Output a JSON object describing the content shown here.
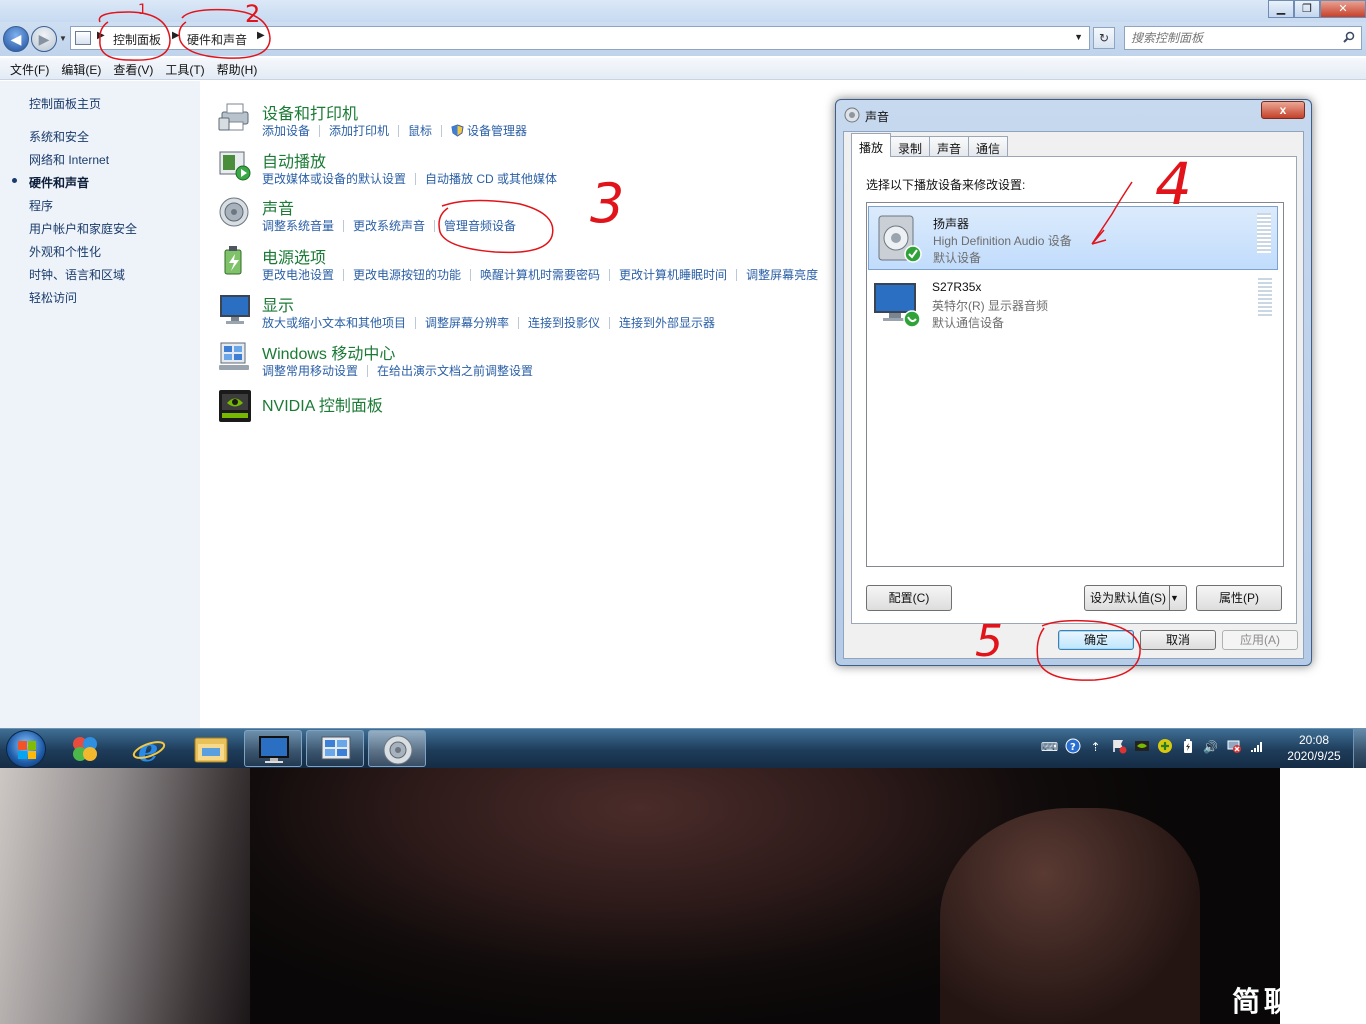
{
  "window": {
    "buttons": {
      "minimize": "▁",
      "maximize": "❐",
      "close": "✕"
    }
  },
  "address": {
    "crumbs": [
      "控制面板",
      "硬件和声音"
    ],
    "search_placeholder": "搜索控制面板"
  },
  "menu": [
    "文件(F)",
    "编辑(E)",
    "查看(V)",
    "工具(T)",
    "帮助(H)"
  ],
  "sidebar": {
    "items": [
      {
        "label": "控制面板主页"
      },
      {
        "label": "系统和安全"
      },
      {
        "label": "网络和 Internet"
      },
      {
        "label": "硬件和声音",
        "active": true
      },
      {
        "label": "程序"
      },
      {
        "label": "用户帐户和家庭安全"
      },
      {
        "label": "外观和个性化"
      },
      {
        "label": "时钟、语言和区域"
      },
      {
        "label": "轻松访问"
      }
    ]
  },
  "categories": [
    {
      "title": "设备和打印机",
      "icon": "printer-icon",
      "links": [
        "添加设备",
        "添加打印机",
        "鼠标",
        "设备管理器"
      ]
    },
    {
      "title": "自动播放",
      "icon": "autoplay-icon",
      "links": [
        "更改媒体或设备的默认设置",
        "自动播放 CD 或其他媒体"
      ]
    },
    {
      "title": "声音",
      "icon": "speaker-icon",
      "links": [
        "调整系统音量",
        "更改系统声音",
        "管理音频设备"
      ]
    },
    {
      "title": "电源选项",
      "icon": "battery-icon",
      "links": [
        "更改电池设置",
        "更改电源按钮的功能",
        "唤醒计算机时需要密码",
        "更改计算机睡眠时间",
        "调整屏幕亮度"
      ]
    },
    {
      "title": "显示",
      "icon": "monitor-icon",
      "links": [
        "放大或缩小文本和其他项目",
        "调整屏幕分辨率",
        "连接到投影仪",
        "连接到外部显示器"
      ]
    },
    {
      "title": "Windows 移动中心",
      "icon": "mobility-center-icon",
      "links": [
        "调整常用移动设置",
        "在给出演示文档之前调整设置"
      ]
    },
    {
      "title": "NVIDIA 控制面板",
      "icon": "nvidia-icon",
      "links": []
    }
  ],
  "dialog": {
    "title": "声音",
    "close": "x",
    "tabs": [
      "播放",
      "录制",
      "声音",
      "通信"
    ],
    "instruction": "选择以下播放设备来修改设置:",
    "devices": [
      {
        "name": "扬声器",
        "desc": "High Definition Audio 设备",
        "status": "默认设备",
        "selected": true
      },
      {
        "name": "S27R35x",
        "desc": "英特尔(R) 显示器音频",
        "status": "默认通信设备",
        "selected": false
      }
    ],
    "buttons": {
      "configure": "配置(C)",
      "set_default": "设为默认值(S)",
      "properties": "属性(P)",
      "ok": "确定",
      "cancel": "取消",
      "apply": "应用(A)"
    }
  },
  "taskbar": {
    "clock": {
      "time": "20:08",
      "date": "2020/9/25"
    }
  },
  "annotations": [
    "1",
    "2",
    "3",
    "4",
    "5"
  ],
  "watermark": "简聊"
}
